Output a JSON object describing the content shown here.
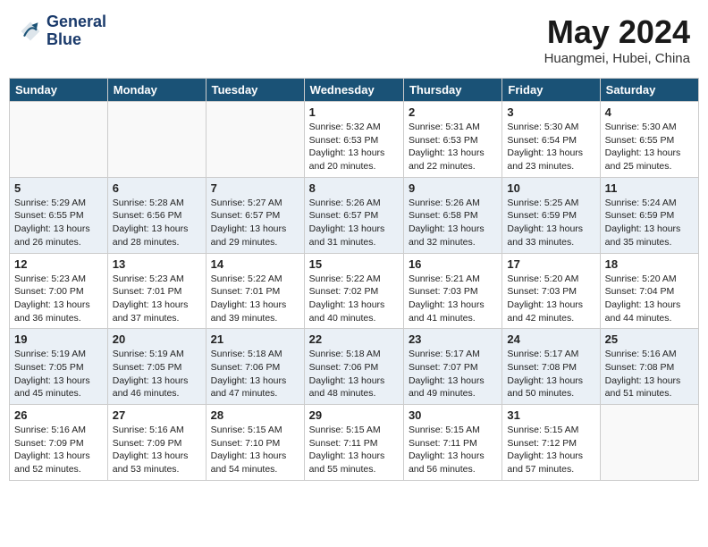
{
  "header": {
    "logo_line1": "General",
    "logo_line2": "Blue",
    "month_year": "May 2024",
    "location": "Huangmei, Hubei, China"
  },
  "days_of_week": [
    "Sunday",
    "Monday",
    "Tuesday",
    "Wednesday",
    "Thursday",
    "Friday",
    "Saturday"
  ],
  "weeks": [
    [
      {
        "day": "",
        "info": ""
      },
      {
        "day": "",
        "info": ""
      },
      {
        "day": "",
        "info": ""
      },
      {
        "day": "1",
        "info": "Sunrise: 5:32 AM\nSunset: 6:53 PM\nDaylight: 13 hours\nand 20 minutes."
      },
      {
        "day": "2",
        "info": "Sunrise: 5:31 AM\nSunset: 6:53 PM\nDaylight: 13 hours\nand 22 minutes."
      },
      {
        "day": "3",
        "info": "Sunrise: 5:30 AM\nSunset: 6:54 PM\nDaylight: 13 hours\nand 23 minutes."
      },
      {
        "day": "4",
        "info": "Sunrise: 5:30 AM\nSunset: 6:55 PM\nDaylight: 13 hours\nand 25 minutes."
      }
    ],
    [
      {
        "day": "5",
        "info": "Sunrise: 5:29 AM\nSunset: 6:55 PM\nDaylight: 13 hours\nand 26 minutes."
      },
      {
        "day": "6",
        "info": "Sunrise: 5:28 AM\nSunset: 6:56 PM\nDaylight: 13 hours\nand 28 minutes."
      },
      {
        "day": "7",
        "info": "Sunrise: 5:27 AM\nSunset: 6:57 PM\nDaylight: 13 hours\nand 29 minutes."
      },
      {
        "day": "8",
        "info": "Sunrise: 5:26 AM\nSunset: 6:57 PM\nDaylight: 13 hours\nand 31 minutes."
      },
      {
        "day": "9",
        "info": "Sunrise: 5:26 AM\nSunset: 6:58 PM\nDaylight: 13 hours\nand 32 minutes."
      },
      {
        "day": "10",
        "info": "Sunrise: 5:25 AM\nSunset: 6:59 PM\nDaylight: 13 hours\nand 33 minutes."
      },
      {
        "day": "11",
        "info": "Sunrise: 5:24 AM\nSunset: 6:59 PM\nDaylight: 13 hours\nand 35 minutes."
      }
    ],
    [
      {
        "day": "12",
        "info": "Sunrise: 5:23 AM\nSunset: 7:00 PM\nDaylight: 13 hours\nand 36 minutes."
      },
      {
        "day": "13",
        "info": "Sunrise: 5:23 AM\nSunset: 7:01 PM\nDaylight: 13 hours\nand 37 minutes."
      },
      {
        "day": "14",
        "info": "Sunrise: 5:22 AM\nSunset: 7:01 PM\nDaylight: 13 hours\nand 39 minutes."
      },
      {
        "day": "15",
        "info": "Sunrise: 5:22 AM\nSunset: 7:02 PM\nDaylight: 13 hours\nand 40 minutes."
      },
      {
        "day": "16",
        "info": "Sunrise: 5:21 AM\nSunset: 7:03 PM\nDaylight: 13 hours\nand 41 minutes."
      },
      {
        "day": "17",
        "info": "Sunrise: 5:20 AM\nSunset: 7:03 PM\nDaylight: 13 hours\nand 42 minutes."
      },
      {
        "day": "18",
        "info": "Sunrise: 5:20 AM\nSunset: 7:04 PM\nDaylight: 13 hours\nand 44 minutes."
      }
    ],
    [
      {
        "day": "19",
        "info": "Sunrise: 5:19 AM\nSunset: 7:05 PM\nDaylight: 13 hours\nand 45 minutes."
      },
      {
        "day": "20",
        "info": "Sunrise: 5:19 AM\nSunset: 7:05 PM\nDaylight: 13 hours\nand 46 minutes."
      },
      {
        "day": "21",
        "info": "Sunrise: 5:18 AM\nSunset: 7:06 PM\nDaylight: 13 hours\nand 47 minutes."
      },
      {
        "day": "22",
        "info": "Sunrise: 5:18 AM\nSunset: 7:06 PM\nDaylight: 13 hours\nand 48 minutes."
      },
      {
        "day": "23",
        "info": "Sunrise: 5:17 AM\nSunset: 7:07 PM\nDaylight: 13 hours\nand 49 minutes."
      },
      {
        "day": "24",
        "info": "Sunrise: 5:17 AM\nSunset: 7:08 PM\nDaylight: 13 hours\nand 50 minutes."
      },
      {
        "day": "25",
        "info": "Sunrise: 5:16 AM\nSunset: 7:08 PM\nDaylight: 13 hours\nand 51 minutes."
      }
    ],
    [
      {
        "day": "26",
        "info": "Sunrise: 5:16 AM\nSunset: 7:09 PM\nDaylight: 13 hours\nand 52 minutes."
      },
      {
        "day": "27",
        "info": "Sunrise: 5:16 AM\nSunset: 7:09 PM\nDaylight: 13 hours\nand 53 minutes."
      },
      {
        "day": "28",
        "info": "Sunrise: 5:15 AM\nSunset: 7:10 PM\nDaylight: 13 hours\nand 54 minutes."
      },
      {
        "day": "29",
        "info": "Sunrise: 5:15 AM\nSunset: 7:11 PM\nDaylight: 13 hours\nand 55 minutes."
      },
      {
        "day": "30",
        "info": "Sunrise: 5:15 AM\nSunset: 7:11 PM\nDaylight: 13 hours\nand 56 minutes."
      },
      {
        "day": "31",
        "info": "Sunrise: 5:15 AM\nSunset: 7:12 PM\nDaylight: 13 hours\nand 57 minutes."
      },
      {
        "day": "",
        "info": ""
      }
    ]
  ]
}
